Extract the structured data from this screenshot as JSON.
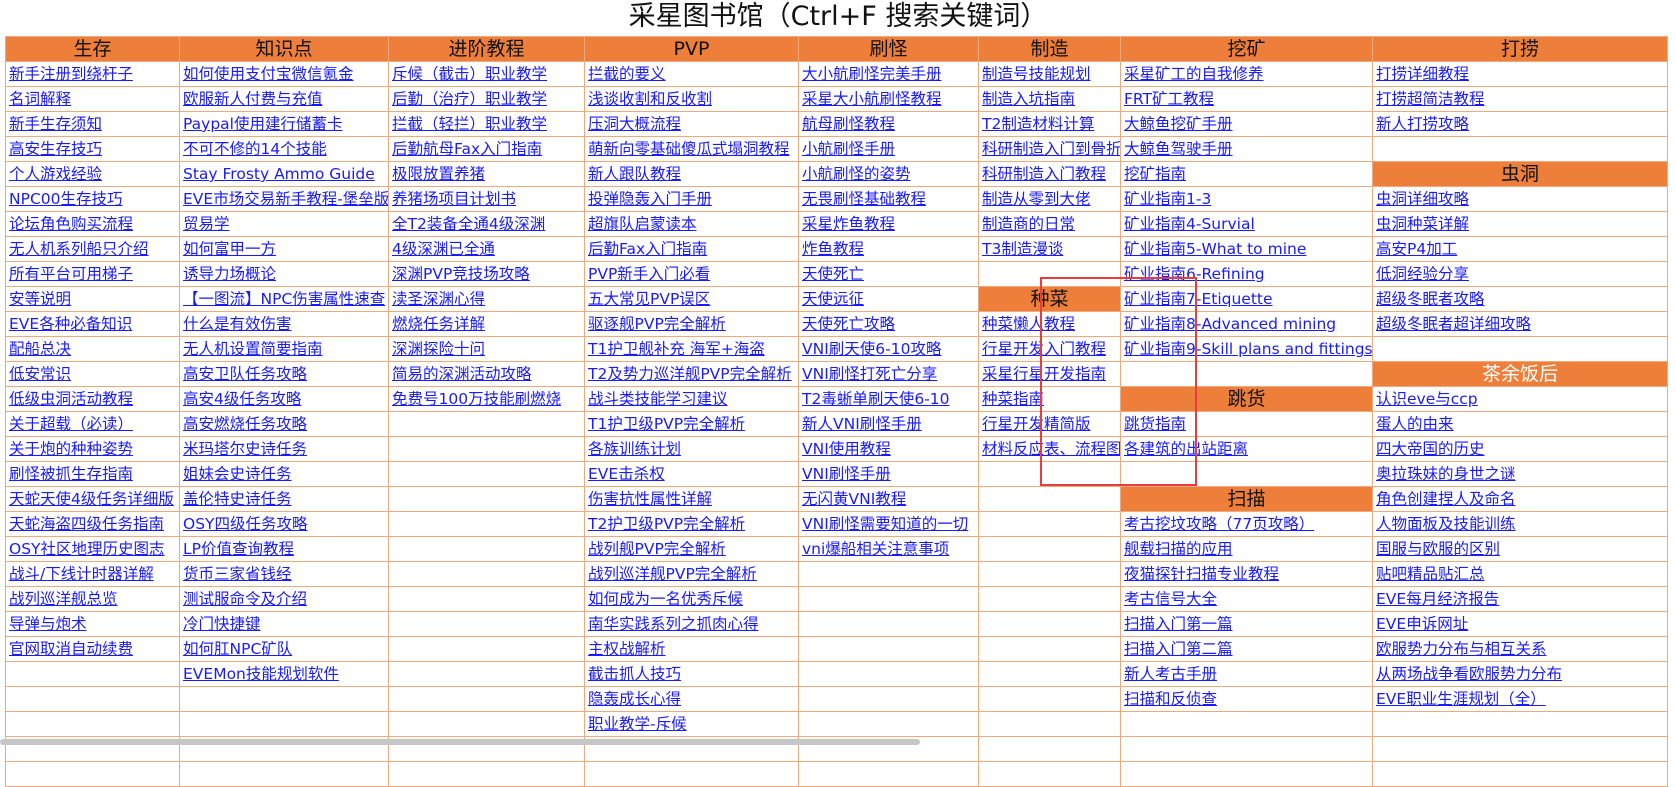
{
  "page": {
    "title": "采星图书馆（Ctrl+F 搜索关键词）"
  },
  "colors": {
    "header_bg": "#ee7f3b",
    "link": "#1a1aff",
    "grid_border": "#f0a97c",
    "highlight_border": "#e63d3d"
  },
  "headers": [
    "生存",
    "知识点",
    "进阶教程",
    "PVP",
    "刷怪",
    "制造",
    "挖矿",
    "打捞"
  ],
  "columns": {
    "survival": [
      "新手注册到绕杆子",
      "名词解释",
      "新手生存须知",
      "高安生存技巧",
      "个人游戏经验",
      "NPC00生存技巧",
      "论坛角色购买流程",
      "无人机系列船只介绍",
      "所有平台可用梯子",
      "安等说明",
      "EVE各种必备知识",
      "配船总决",
      "低安常识",
      "低级虫洞活动教程",
      "关于超载（必读）",
      "关于炮的种种姿势",
      "刷怪被抓生存指南",
      "天蛇天使4级任务详细版",
      "天蛇海盗四级任务指南",
      "OSY社区地理历史图志",
      "战斗/下线计时器详解",
      "战列巡洋舰总览",
      "导弹与炮术",
      "官网取消自动续费"
    ],
    "knowledge": [
      "如何使用支付宝微信氪金",
      "欧服新人付费与充值",
      "Paypal使用建行储蓄卡",
      "不可不修的14个技能",
      "Stay Frosty Ammo Guide",
      "EVE市场交易新手教程-堡垒版",
      "贸易学",
      "如何富甲一方",
      "诱导力场概论",
      "【一图流】NPC伤害属性速查",
      "什么是有效伤害",
      "无人机设置简要指南",
      "高安卫队任务攻略",
      "高安4级任务攻略",
      "高安燃烧任务攻略",
      "米玛塔尔史诗任务",
      "姐妹会史诗任务",
      "盖伦特史诗任务",
      "OSY四级任务攻略",
      "LP价值查询教程",
      "货币三家省钱经",
      "测试服命令及介绍",
      "冷门快捷键",
      "如何肛NPC矿队",
      "EVEMon技能规划软件"
    ],
    "advanced": [
      "斥候（截击）职业教学",
      "后勤（治疗）职业教学",
      "拦截（轻拦）职业教学",
      "后勤航母Fax入门指南",
      "极限放置养猪",
      "养猪场项目计划书",
      "全T2装备全通4级深渊",
      "4级深渊已全通",
      "深渊PVP竞技场攻略",
      "渎圣深渊心得",
      "燃烧任务详解",
      "深渊探险十问",
      "简易的深渊活动攻略",
      "免费号100万技能刷燃烧"
    ],
    "pvp": [
      "拦截的要义",
      "浅谈收割和反收割",
      "压洞大概流程",
      "萌新向零基础傻瓜式塌洞教程",
      "新人跟队教程",
      "投弹隐轰入门手册",
      "超旗队启蒙读本",
      "后勤Fax入门指南",
      "PVP新手入门必看",
      "五大常见PVP误区",
      "驱逐舰PVP完全解析",
      "T1护卫舰补充 海军+海盗",
      "T2及势力巡洋舰PVP完全解析",
      "战斗类技能学习建议",
      "T1护卫级PVP完全解析",
      "各族训练计划",
      "EVE击杀权",
      "伤害抗性属性详解",
      "T2护卫级PVP完全解析",
      "战列舰PVP完全解析",
      "战列巡洋舰PVP完全解析",
      "如何成为一名优秀斥候",
      "南华实践系列之抓肉心得",
      "主权战解析",
      "截击抓人技巧",
      "隐轰成长心得",
      "职业教学-斥候"
    ],
    "ratting": [
      "大小航刷怪完美手册",
      "采星大小航刷怪教程",
      "航母刷怪教程",
      "小航刷怪手册",
      "小航刷怪的姿势",
      "无畏刷怪基础教程",
      "采星炸鱼教程",
      "炸鱼教程",
      "天使死亡",
      "天使远征",
      "天使死亡攻略",
      "VNI刷天使6-10攻略",
      "VNI刷怪打死亡分享",
      "T2毒蜥单刷天使6-10",
      "新人VNI刷怪手册",
      "VNI使用教程",
      "VNI刷怪手册",
      "无闪黄VNI教程",
      "VNI刷怪需要知道的一切",
      "vni爆船相关注意事项"
    ],
    "manufacturing": [
      "制造号技能规划",
      "制造入坑指南",
      "T2制造材料计算",
      "科研制造入门到骨折",
      "科研制造入门教程",
      "制造从零到大佬",
      "制造商的日常",
      "T3制造漫谈"
    ],
    "pi_title": "种菜",
    "pi": [
      "种菜懒人教程",
      "行星开发入门教程",
      "采星行星开发指南",
      "种菜指南",
      "行星开发精简版",
      "材料反应表、流程图"
    ],
    "mining": [
      "采星矿工的自我修养",
      "FRT矿工教程",
      "大鲸鱼挖矿手册",
      "大鲸鱼驾驶手册",
      "挖矿指南",
      "矿业指南1-3",
      "矿业指南4-Survial",
      "矿业指南5-What to mine",
      "矿业指南6-Refining",
      "矿业指南7-Etiquette",
      "矿业指南8-Advanced mining",
      "矿业指南9-Skill plans and fittings"
    ],
    "hauling_title": "跳货",
    "hauling": [
      "跳货指南",
      "各建筑的出站距离"
    ],
    "scanning_title": "扫描",
    "scanning": [
      "考古挖坟攻略（77页攻略）",
      "舰载扫描的应用",
      "夜猫探针扫描专业教程",
      "考古信号大全",
      "扫描入门第一篇",
      "扫描入门第二篇",
      "新人考古手册",
      "扫描和反侦查"
    ],
    "salvage": [
      "打捞详细教程",
      "打捞超简洁教程",
      "新人打捞攻略"
    ],
    "wormhole_title": "虫洞",
    "wormhole": [
      "虫洞详细攻略",
      "虫洞种菜详解",
      "高安P4加工",
      "低洞经验分享",
      "超级冬眠者攻略",
      "超级冬眠者超详细攻略"
    ],
    "teatime_title": "茶余饭后",
    "teatime": [
      "认识eve与ccp",
      "蛋人的由来",
      "四大帝国的历史",
      "奥拉珠妹的身世之谜",
      "角色创建捏人及命名",
      "人物面板及技能训练",
      "国服与欧服的区别",
      "贴吧精品贴汇总",
      "EVE每月经济报告",
      "EVE申诉网址",
      "欧服势力分布与相互关系",
      "从两场战争看欧服势力分布",
      "EVE职业生涯规划（全）"
    ]
  }
}
